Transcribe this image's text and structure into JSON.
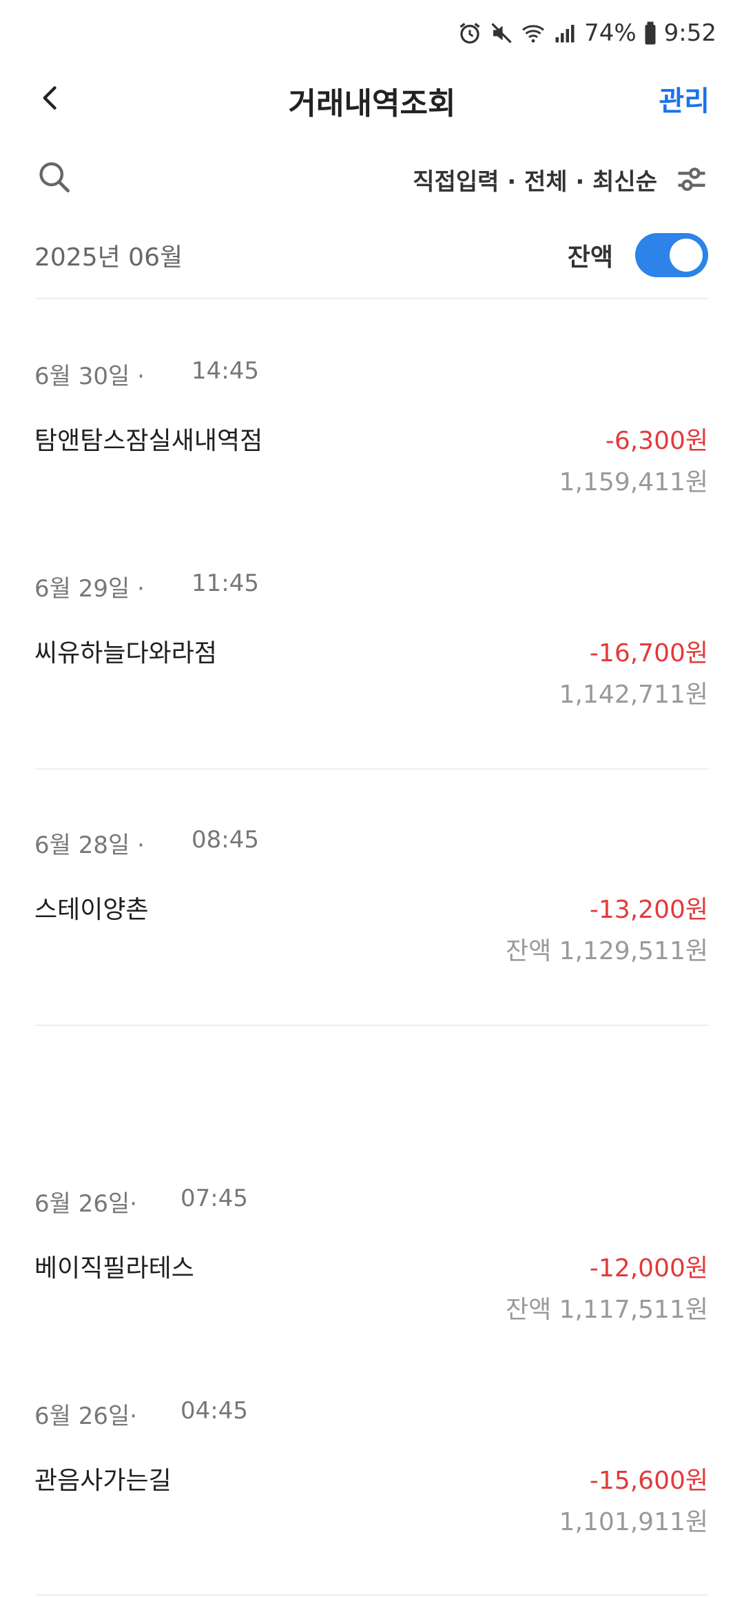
{
  "status_bar": {
    "battery": "74%",
    "time": "9:52",
    "icons": [
      "alarm-icon",
      "mute-icon",
      "wifi-icon",
      "signal-icon",
      "battery-icon"
    ]
  },
  "header": {
    "title": "거래내역조회",
    "manage_label": "관리"
  },
  "filter": {
    "summary": "직접입력 · 전체 · 최신순"
  },
  "month": {
    "label": "2025년 06월",
    "balance_toggle_label": "잔액",
    "balance_toggle_on": true
  },
  "colors": {
    "accent": "#1a73e8",
    "toggle": "#2d83e8",
    "debit": "#e23a3a",
    "muted": "#999999"
  },
  "transactions": [
    {
      "date": "6월 30일 ·",
      "time": "14:45",
      "merchant": "탐앤탐스잠실새내역점",
      "amount": "-6,300원",
      "balance": "1,159,411원"
    },
    {
      "date": "6월 29일 ·",
      "time": "11:45",
      "merchant": "씨유하늘다와라점",
      "amount": "-16,700원",
      "balance": "1,142,711원"
    },
    {
      "date": "6월 28일 ·",
      "time": "08:45",
      "merchant": "스테이양촌",
      "amount": "-13,200원",
      "balance": "잔액 1,129,511원"
    },
    {
      "date": "6월 26일·",
      "time": "07:45",
      "merchant": "베이직필라테스",
      "amount": "-12,000원",
      "balance": "잔액 1,117,511원"
    },
    {
      "date": "6월 26일·",
      "time": "04:45",
      "merchant": "관음사가는길",
      "amount": "-15,600원",
      "balance": "1,101,911원"
    }
  ]
}
